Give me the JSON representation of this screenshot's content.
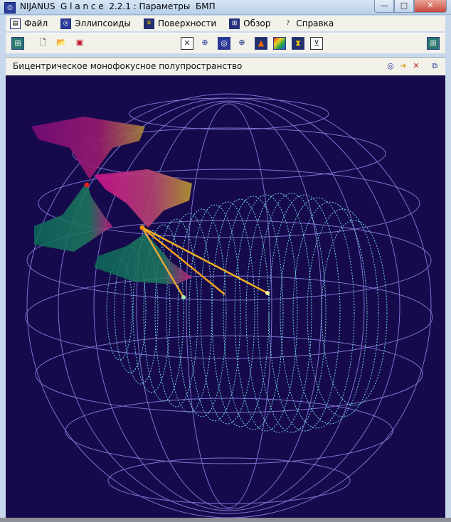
{
  "window": {
    "title": "NIJANUS  G l a n c e  2.2.1 : Параметры  БМП",
    "controls": {
      "minimize": "—",
      "maximize": "□",
      "close": "✕"
    }
  },
  "menu": [
    {
      "label": "Файл",
      "icon": "file-icon"
    },
    {
      "label": "Эллипсоиды",
      "icon": "ellipsoids-icon"
    },
    {
      "label": "Поверхности",
      "icon": "surfaces-icon"
    },
    {
      "label": "Обзор",
      "icon": "overview-icon"
    },
    {
      "label": "Справка",
      "icon": "help-icon"
    }
  ],
  "toolbar": {
    "buttons": [
      "table-icon",
      "new-file-icon",
      "open-folder-icon",
      "save-icon",
      "axes-icon",
      "globe-grid-icon",
      "ellipsoid-icon",
      "globe-icon",
      "surface-icon",
      "palette-icon",
      "hourglass-icon",
      "select-icon",
      "table-right-icon"
    ]
  },
  "subheader": {
    "title": "Бицентрическое  монофокусное  полупространство",
    "icons": [
      "ellipsoid-view-icon",
      "arrow-right-icon",
      "reset-icon",
      "restore-icon"
    ]
  },
  "colors": {
    "viewport_bg": "#170a4c",
    "wire": "#8a86e6",
    "mesh": "#6fd6e8",
    "focus_point": "#e02020",
    "ray": "#f0a020"
  }
}
